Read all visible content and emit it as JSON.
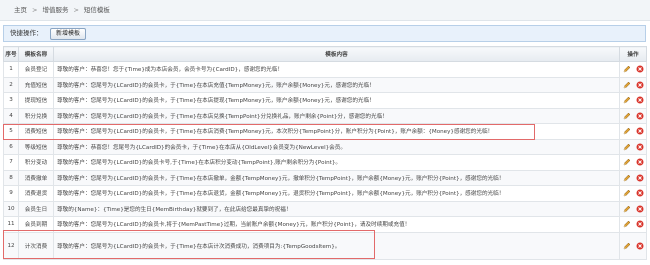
{
  "breadcrumb": {
    "home": "主页",
    "sep1": ">",
    "section": "增值服务",
    "sep2": ">",
    "page": "短信模板"
  },
  "quick": {
    "label": "快捷操作：",
    "new_button": "新增模板"
  },
  "table": {
    "headers": {
      "no": "序号",
      "name": "模板名称",
      "content": "模板内容",
      "ops": "操作"
    },
    "rows": [
      {
        "no": "1",
        "name": "会员登记",
        "content": "尊敬的客户：恭喜您！您于{Time}成为本店会员，会员卡号为{CardID}，感谢您的光临！"
      },
      {
        "no": "2",
        "name": "充值短信",
        "content": "尊敬的客户：您尾号为{LCardID}的会员卡，于{Time}在本店充值{TempMoney}元，账户余额{Money}元，感谢您的光临！"
      },
      {
        "no": "3",
        "name": "提现短信",
        "content": "尊敬的客户：您尾号为{LCardID}的会员卡，于{Time}在本店提现{TempMoney}元，账户余额{Money}元，感谢您的光临！"
      },
      {
        "no": "4",
        "name": "积分兑换",
        "content": "尊敬的客户：您尾号为{LCardID}的会员卡，于{Time}在本店兑换{TempPoint}分兑换礼品，账户剩余{Point}分，感谢您的光临！"
      },
      {
        "no": "5",
        "name": "消费短信",
        "content": "尊敬的客户：您尾号为{LCardID}的会员卡，于{Time}在本店消费{TempMoney}元，本次积分{TempPoint}分，账户积分为{Point}，账户余额：{Money}感谢您的光临！"
      },
      {
        "no": "6",
        "name": "等级短信",
        "content": "尊敬的客户：恭喜您！您尾号为{LCardID}的会员卡，于{Time}在本店从{OldLevel}会员变为{NewLevel}会员。"
      },
      {
        "no": "7",
        "name": "积分变动",
        "content": "尊敬的客户：您尾号为{LCardID}的会员卡号,于{Time}在本店积分变动{TempPoint},账户剩余积分为{Point}。"
      },
      {
        "no": "8",
        "name": "消费撤单",
        "content": "尊敬的客户：您尾号为{LCardID}的会员卡，于{Time}在本店撤单，金额{TempMoney}元，撤单积分{TempPoint}，账户余额{Money}元，账户积分{Point}，感谢您的光临！"
      },
      {
        "no": "9",
        "name": "消费退货",
        "content": "尊敬的客户：您尾号为{LCardID}的会员卡，于{Time}在本店退货，金额{TempMoney}元，退货积分{TempPoint}，账户余额{Money}元，账户积分{Point}，感谢您的光临！"
      },
      {
        "no": "10",
        "name": "会员生日",
        "content": "尊敬的{Name}：{Time}是您的生日{MemBirthday}就要到了，在此店给您最真挚的祝福！"
      },
      {
        "no": "11",
        "name": "会员到期",
        "content": "尊敬的客户：您尾号为{LCardID}的会员卡,将于{MemPastTime}过期，当前账户余额{Money}元，账户积分{Point}，请及时续期或充值！"
      },
      {
        "no": "12",
        "name": "计次消费",
        "content": "尊敬的客户：您尾号为{LCardID}的会员卡，于{Time}在本店计次消费成功，消费项目为:{TempGoodsItem}。"
      }
    ]
  },
  "icons": {
    "edit": "pencil-icon",
    "delete": "delete-icon"
  },
  "colors": {
    "highlight": "#e26a6a",
    "delete": "#d9342b",
    "edit": "#c88a1c"
  }
}
